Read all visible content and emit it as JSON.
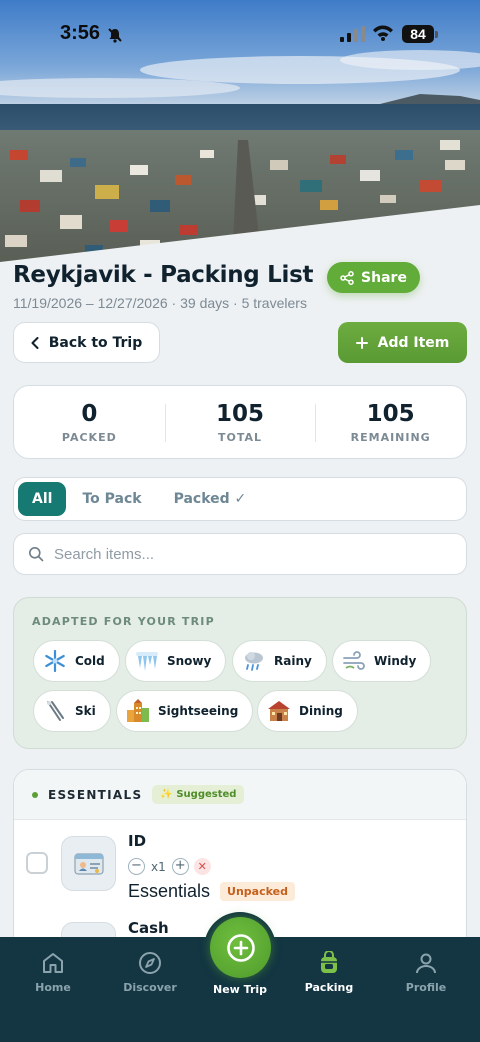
{
  "status_bar": {
    "time": "3:56",
    "battery": "84"
  },
  "header": {
    "title": "Reykjavik - Packing List",
    "share_label": "Share",
    "subtitle": "11/19/2026 – 12/27/2026 · 39 days · 5 travelers"
  },
  "actions": {
    "back_label": "Back to Trip",
    "add_label": "Add Item"
  },
  "stats": [
    {
      "value": "0",
      "label": "PACKED"
    },
    {
      "value": "105",
      "label": "TOTAL"
    },
    {
      "value": "105",
      "label": "REMAINING"
    }
  ],
  "filter_tabs": [
    {
      "label": "All",
      "active": true
    },
    {
      "label": "To Pack",
      "active": false
    },
    {
      "label": "Packed ✓",
      "active": false
    }
  ],
  "search": {
    "placeholder": "Search items..."
  },
  "adapted": {
    "title": "ADAPTED FOR YOUR TRIP",
    "chips": [
      {
        "label": "Cold",
        "icon": "snowflake-icon"
      },
      {
        "label": "Snowy",
        "icon": "icicles-icon"
      },
      {
        "label": "Rainy",
        "icon": "rain-cloud-icon"
      },
      {
        "label": "Windy",
        "icon": "wind-icon"
      },
      {
        "label": "Ski",
        "icon": "ski-icon"
      },
      {
        "label": "Sightseeing",
        "icon": "buildings-icon"
      },
      {
        "label": "Dining",
        "icon": "restaurant-icon"
      }
    ]
  },
  "category": {
    "name": "ESSENTIALS",
    "badge": "✨ Suggested",
    "items": [
      {
        "name": "ID",
        "quantity": "x1",
        "category": "Essentials",
        "status": "Unpacked",
        "icon": "id-card-icon"
      },
      {
        "name": "Cash",
        "icon": "cash-icon"
      }
    ]
  },
  "bottom_nav": {
    "items": [
      {
        "label": "Home",
        "icon": "home-icon"
      },
      {
        "label": "Discover",
        "icon": "compass-icon"
      },
      {
        "label": "New Trip",
        "icon": "plus-circle-icon"
      },
      {
        "label": "Packing",
        "icon": "backpack-icon",
        "active": true
      },
      {
        "label": "Profile",
        "icon": "person-icon"
      }
    ]
  },
  "colors": {
    "primary_green": "#62ac3a",
    "teal": "#167a72",
    "nav_bg": "#133642",
    "unpacked": "#c5601c"
  }
}
